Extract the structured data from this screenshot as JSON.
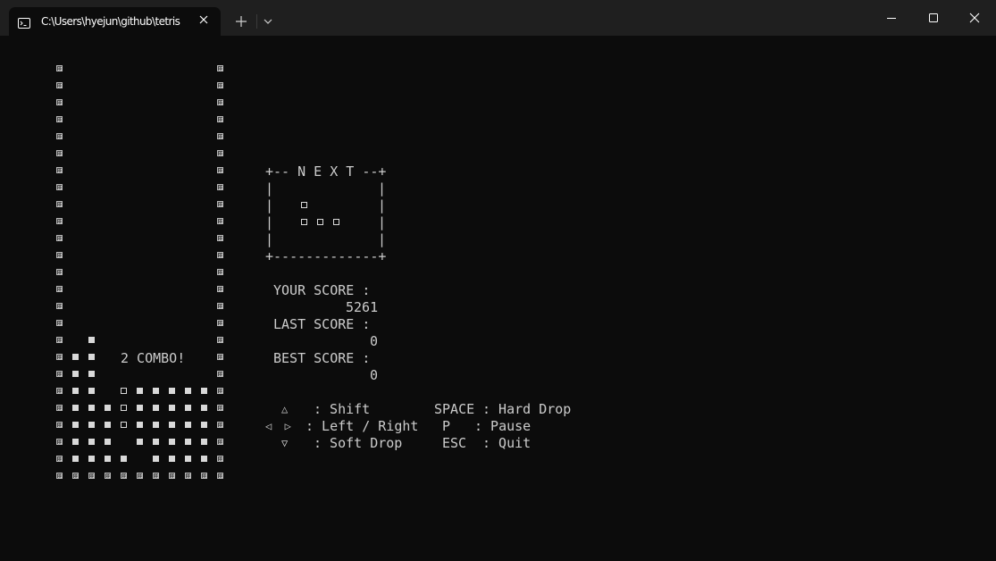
{
  "window": {
    "tab_title": "C:\\Users\\hyejun\\github\\tetris",
    "icon": "terminal-icon",
    "new_tab_icon": "plus-icon",
    "dropdown_icon": "chevron-down-icon",
    "controls": [
      "minimize-icon",
      "maximize-icon",
      "close-icon"
    ]
  },
  "game": {
    "combo_text": "2 COMBO!",
    "next_box": {
      "top": "+-- N E X T --+",
      "side": "|",
      "bottom": "+-------------+"
    },
    "your_score_label": "YOUR SCORE :",
    "your_score_value": "5261",
    "last_score_label": "LAST SCORE :",
    "last_score_value": "0",
    "best_score_label": "BEST SCORE :",
    "best_score_value": "0"
  },
  "controls_help": {
    "up_symbol": "△",
    "shift_text": ": Shift",
    "left_right_symbols": "◁  ▷",
    "left_right_text": ": Left / Right",
    "down_symbol": "▽",
    "soft_drop_text": ": Soft Drop",
    "space_key": "SPACE",
    "hard_drop_text": ": Hard Drop",
    "p_key": "P",
    "pause_text": ": Pause",
    "esc_key": "ESC",
    "quit_text": ": Quit"
  },
  "colors": {
    "background": "#0c0c0c",
    "titlebar": "#1f1f1f",
    "text": "#cccccc"
  }
}
